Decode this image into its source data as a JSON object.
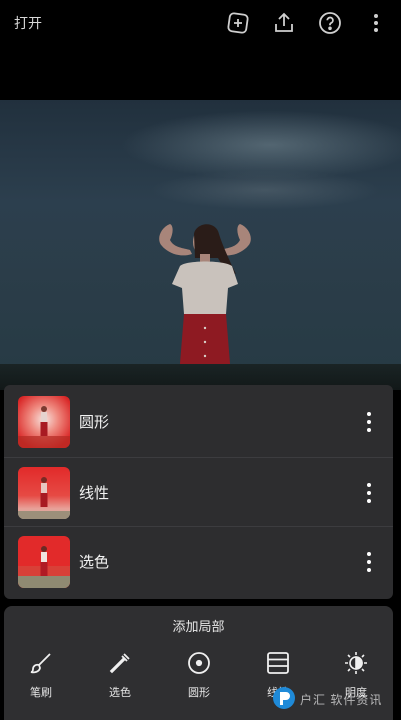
{
  "topbar": {
    "open_label": "打开",
    "icons": [
      "add-layer-icon",
      "share-icon",
      "help-icon",
      "more-vertical-icon"
    ]
  },
  "masks": [
    {
      "label": "圆形",
      "thumb": "radial"
    },
    {
      "label": "线性",
      "thumb": "linear"
    },
    {
      "label": "选色",
      "thumb": "color"
    }
  ],
  "sheet": {
    "title": "添加局部",
    "tools": [
      {
        "label": "笔刷",
        "icon": "brush-icon"
      },
      {
        "label": "选色",
        "icon": "eyedropper-icon"
      },
      {
        "label": "圆形",
        "icon": "radial-icon"
      },
      {
        "label": "线性",
        "icon": "linear-icon"
      },
      {
        "label": "明度",
        "icon": "luminance-icon"
      }
    ]
  },
  "colors": {
    "mask_red": "#e22a2a",
    "panel": "#2d2d2f",
    "sheet": "#2f2f31"
  }
}
